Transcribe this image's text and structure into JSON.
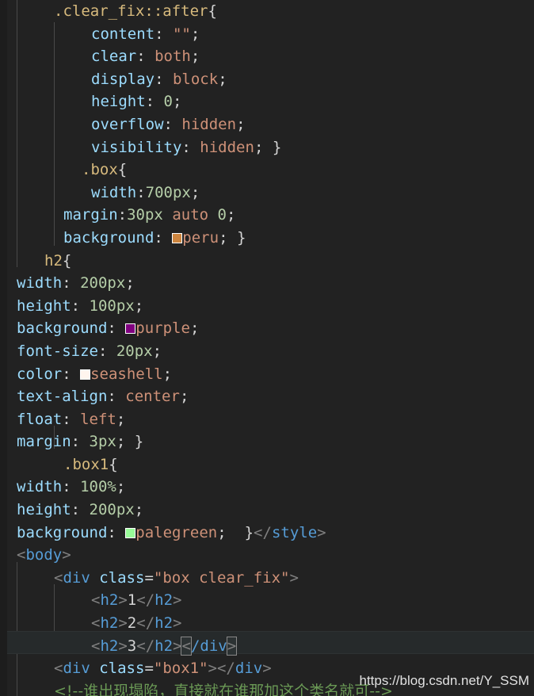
{
  "editor": {
    "background": "#222222",
    "gutter_color": "#1d1d1d",
    "indent_guide_color": "#4a4a4a",
    "current_line_background": "#262a2b"
  },
  "theme": {
    "selector": "#d7ba7d",
    "property": "#9cdcfe",
    "value": "#ce9178",
    "number": "#b5cea8",
    "punctuation": "#d4d4d4",
    "bracket": "#808080",
    "tag": "#569cd6",
    "text": "#d4d4d4",
    "comment": "#6a9955"
  },
  "swatches": {
    "peru": "#cd853f",
    "purple": "#800080",
    "seashell": "#fff5ee",
    "palegreen": "#98fb98"
  },
  "code": {
    "l1": {
      "selector": ".clear_fix::after",
      "brace": "{"
    },
    "l2": {
      "prop": "content",
      "colon": ":",
      "value": "\"\"",
      "semi": ";"
    },
    "l3": {
      "prop": "clear",
      "colon": ":",
      "value": "both",
      "semi": ";"
    },
    "l4": {
      "prop": "display",
      "colon": ":",
      "value": "block",
      "semi": ";"
    },
    "l5": {
      "prop": "height",
      "colon": ":",
      "value": "0",
      "semi": ";"
    },
    "l6": {
      "prop": "overflow",
      "colon": ":",
      "value": "hidden",
      "semi": ";"
    },
    "l7": {
      "prop": "visibility",
      "colon": ":",
      "value": "hidden",
      "semi": ";",
      "close": "}"
    },
    "l8": {
      "selector": ".box",
      "brace": "{"
    },
    "l9": {
      "prop": "width",
      "colon": ":",
      "value": "700px",
      "semi": ";"
    },
    "l10": {
      "prop": "margin",
      "colon": ":",
      "v1": "30px",
      "v2": "auto",
      "v3": "0",
      "semi": ";"
    },
    "l11": {
      "prop": "background",
      "colon": ":",
      "value": "peru",
      "semi": ";",
      "close": "}",
      "swatch": "peru"
    },
    "l12": {
      "selector": "h2",
      "brace": "{"
    },
    "l13": {
      "prop": "width",
      "colon": ":",
      "value": "200px",
      "semi": ";"
    },
    "l14": {
      "prop": "height",
      "colon": ":",
      "value": "100px",
      "semi": ";"
    },
    "l15": {
      "prop": "background",
      "colon": ":",
      "value": "purple",
      "semi": ";",
      "swatch": "purple"
    },
    "l16": {
      "prop": "font-size",
      "colon": ":",
      "value": "20px",
      "semi": ";"
    },
    "l17": {
      "prop": "color",
      "colon": ":",
      "value": "seashell",
      "semi": ";",
      "swatch": "seashell"
    },
    "l18": {
      "prop": "text-align",
      "colon": ":",
      "value": "center",
      "semi": ";"
    },
    "l19": {
      "prop": "float",
      "colon": ":",
      "value": "left",
      "semi": ";"
    },
    "l20": {
      "prop": "margin",
      "colon": ":",
      "value": "3px",
      "semi": ";",
      "close": "}"
    },
    "l21": {
      "selector": ".box1",
      "brace": "{"
    },
    "l22": {
      "prop": "width",
      "colon": ":",
      "value": "100%",
      "semi": ";"
    },
    "l23": {
      "prop": "height",
      "colon": ":",
      "value": "200px",
      "semi": ";"
    },
    "l24": {
      "prop": "background",
      "colon": ":",
      "value": "palegreen",
      "semi": ";",
      "close": "}",
      "swatch": "palegreen",
      "style_close_open": "</",
      "style_close_tag": "style",
      "style_close_gt": ">"
    },
    "l25": {
      "lt": "<",
      "tag": "body",
      "gt": ">"
    },
    "l26": {
      "lt": "<",
      "tag": "div",
      "space": " ",
      "attr": "class",
      "eq": "=",
      "value": "\"box clear_fix\"",
      "gt": ">"
    },
    "l27": {
      "open_lt": "<",
      "open_tag": "h2",
      "open_gt": ">",
      "text": "1",
      "close_lt": "</",
      "close_tag": "h2",
      "close_gt": ">"
    },
    "l28": {
      "open_lt": "<",
      "open_tag": "h2",
      "open_gt": ">",
      "text": "2",
      "close_lt": "</",
      "close_tag": "h2",
      "close_gt": ">"
    },
    "l29": {
      "open_lt": "<",
      "open_tag": "h2",
      "open_gt": ">",
      "text": "3",
      "close_lt": "</",
      "close_tag": "h2",
      "close_gt": ">",
      "div_lt": "<",
      "div_slash_tag": "/div",
      "div_gt": ">"
    },
    "l30": {
      "lt": "<",
      "tag": "div",
      "space": " ",
      "attr": "class",
      "eq": "=",
      "value": "\"box1\"",
      "gt": ">",
      "close_lt": "</",
      "close_tag": "div",
      "close_gt": ">"
    },
    "l31": {
      "comment": "<!--谁出现塌陷，直接就在谁那加这个类名就可-->"
    }
  },
  "watermark": {
    "text": "https://blog.csdn.net/Y_SSM"
  }
}
